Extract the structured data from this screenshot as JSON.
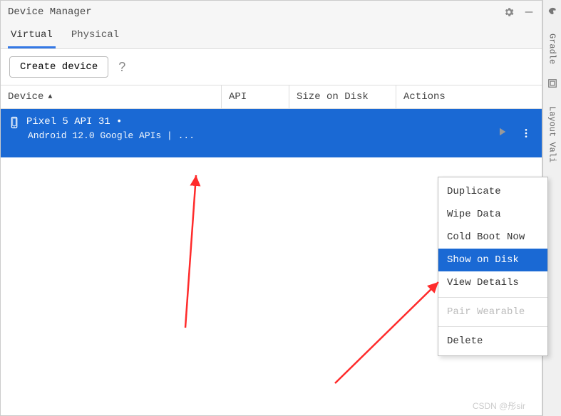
{
  "titlebar": {
    "title": "Device Manager"
  },
  "tabs": {
    "virtual": "Virtual",
    "physical": "Physical"
  },
  "toolbar": {
    "create_label": "Create device",
    "help_glyph": "?"
  },
  "columns": {
    "device": "Device",
    "api": "API",
    "size": "Size on Disk",
    "actions": "Actions",
    "sort_arrow": "▲"
  },
  "rows": [
    {
      "name": "Pixel 5 API 31 •",
      "subtitle": "Android 12.0 Google APIs | ...",
      "api": "",
      "size": ""
    }
  ],
  "context_menu": {
    "duplicate": "Duplicate",
    "wipe": "Wipe Data",
    "cold_boot": "Cold Boot Now",
    "show_disk": "Show on Disk",
    "view_details": "View Details",
    "pair": "Pair Wearable",
    "delete": "Delete"
  },
  "rail": {
    "gradle": "Gradle",
    "layout": "Layout Vali"
  },
  "watermark": "CSDN @彤sir"
}
